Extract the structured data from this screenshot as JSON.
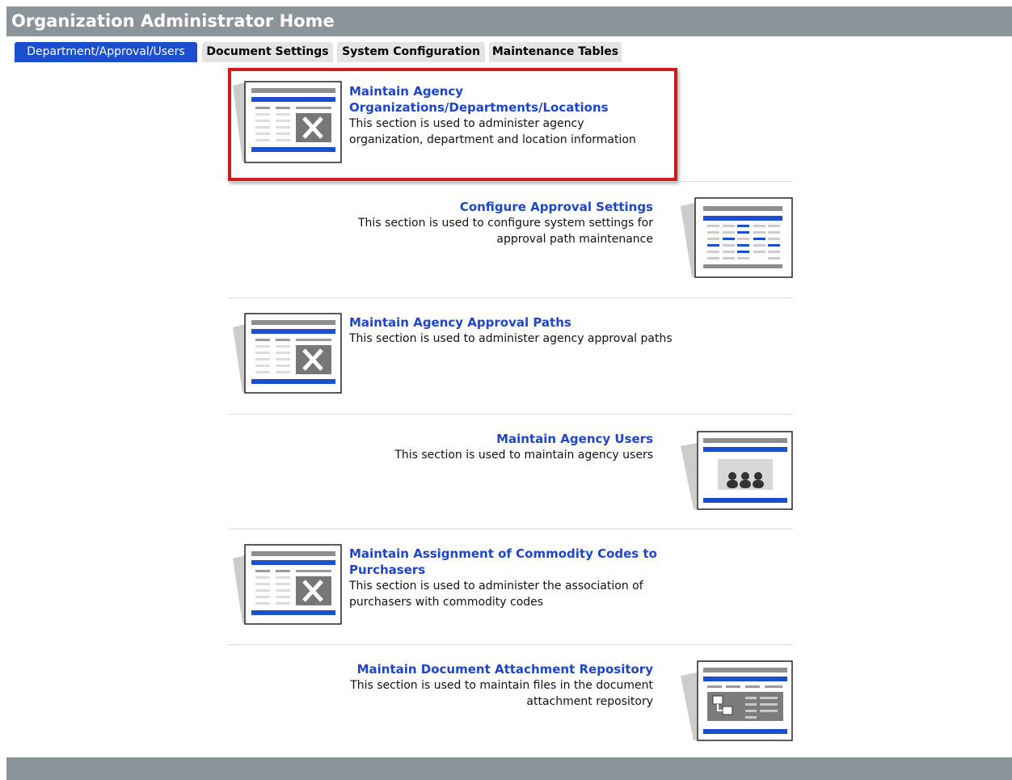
{
  "title": "Organization Administrator Home",
  "tabs": [
    {
      "label": "Department/Approval/Users",
      "active": true
    },
    {
      "label": "Document Settings",
      "active": false
    },
    {
      "label": "System Configuration",
      "active": false
    },
    {
      "label": "Maintenance Tables",
      "active": false
    }
  ],
  "sections": [
    {
      "link_lines": [
        "Maintain Agency",
        "Organizations/Departments/Locations"
      ],
      "desc_lines": [
        "This section is used to administer agency",
        "organization, department and location information"
      ],
      "icon": "tools-icon"
    },
    {
      "link_lines": [
        "Configure Approval Settings"
      ],
      "desc_lines": [
        "This section is used to configure system settings for",
        "approval path maintenance"
      ],
      "icon": "grid-icon"
    },
    {
      "link_lines": [
        "Maintain Agency Approval Paths"
      ],
      "desc_lines": [
        "This section is used to administer agency approval paths"
      ],
      "icon": "tools-icon"
    },
    {
      "link_lines": [
        "Maintain Agency Users"
      ],
      "desc_lines": [
        "This section is used to maintain agency users"
      ],
      "icon": "users-icon"
    },
    {
      "link_lines": [
        "Maintain Assignment of Commodity Codes to",
        "Purchasers"
      ],
      "desc_lines": [
        "This section is used to administer the association of",
        "purchasers with commodity codes"
      ],
      "icon": "tools-icon"
    },
    {
      "link_lines": [
        "Maintain Document Attachment Repository"
      ],
      "desc_lines": [
        "This section is used to maintain files in the document",
        "attachment repository"
      ],
      "icon": "folder-tree-icon"
    }
  ],
  "colors": {
    "title_bar": "#8b9499",
    "active_tab": "#1c4fcf",
    "link": "#1c46cc",
    "highlight": "#d11a1a"
  }
}
